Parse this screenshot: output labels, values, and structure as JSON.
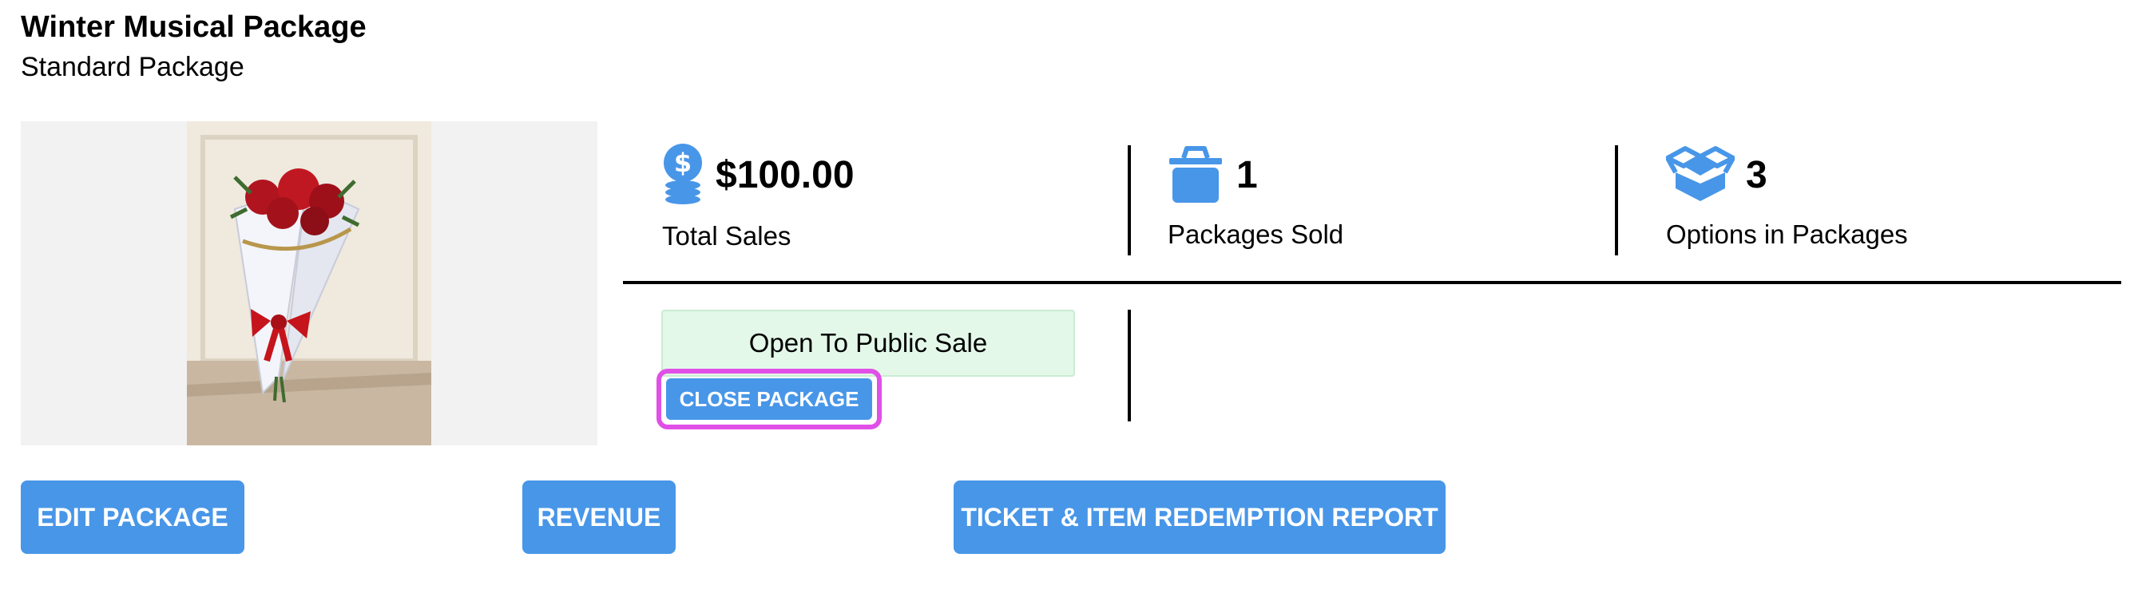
{
  "header": {
    "title": "Winter Musical Package",
    "subtitle": "Standard Package"
  },
  "stats": [
    {
      "icon": "dollar-coins-icon",
      "value": "$100.00",
      "label": "Total Sales"
    },
    {
      "icon": "basket-icon",
      "value": "1",
      "label": "Packages Sold"
    },
    {
      "icon": "open-box-icon",
      "value": "3",
      "label": "Options in Packages"
    }
  ],
  "status": {
    "label": "Open To Public Sale",
    "close_button": "CLOSE PACKAGE"
  },
  "actions": {
    "edit": "EDIT PACKAGE",
    "revenue": "REVENUE",
    "redemption_report": "TICKET & ITEM REDEMPTION REPORT"
  },
  "colors": {
    "accent": "#4896e8",
    "highlight": "#e04fe6",
    "status_bg": "#e3f8e9"
  }
}
